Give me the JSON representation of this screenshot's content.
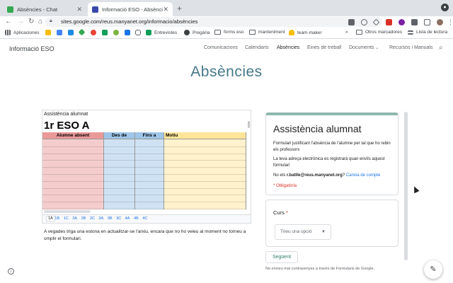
{
  "browser": {
    "tabs": [
      {
        "title": "Absències - Chat",
        "active": false,
        "color": "#34a853"
      },
      {
        "title": "Informació ESO - Absències",
        "active": true,
        "color": "#3949ab"
      }
    ],
    "url": "sites.google.com/reus.manyanet.org/informacio/absències",
    "bookmarks": [
      {
        "label": "Aplicaciones",
        "icon": "apps-grid-icon"
      },
      {
        "label": "Entrevistes",
        "icon": "sheets-icon"
      },
      {
        "label": "Pregària",
        "icon": "globe-icon"
      },
      {
        "label": "forms eso",
        "icon": "folder-icon"
      },
      {
        "label": "manteniment",
        "icon": "folder-icon"
      },
      {
        "label": "team-maker",
        "icon": "bulb-icon"
      },
      {
        "label": "Otros marcadores",
        "icon": "folder-icon"
      },
      {
        "label": "Lista de lectura",
        "icon": "reading-list-icon"
      }
    ],
    "more_bookmarks": "»"
  },
  "site": {
    "title": "Informació ESO",
    "nav": [
      "Comunicacions",
      "Calendaris",
      "Absències",
      "Eines de treball",
      "Documents",
      "Recursos i Manuals"
    ],
    "active_nav": "Absències",
    "page_heading": "Absències"
  },
  "sheet": {
    "label": "Assistència alumnat",
    "heading": "1r ESO A",
    "columns": [
      {
        "name": "Alumne absent",
        "color": "#f4cccc",
        "head": "#ea9999"
      },
      {
        "name": "Des de",
        "color": "#cfe2f3",
        "head": "#9fc5e8"
      },
      {
        "name": "Fins a",
        "color": "#cfe2f3",
        "head": "#9fc5e8"
      },
      {
        "name": "Motiu",
        "color": "#fff2cc",
        "head": "#ffe599"
      }
    ],
    "tabs": [
      "1A",
      "1B",
      "1C",
      "2A",
      "2B",
      "2C",
      "3A",
      "3B",
      "3C",
      "4A",
      "4B",
      "4C"
    ],
    "selected_tab": "1A"
  },
  "note": "A vegades triga una estona en actualitzar-se l'arxiu, encara que no ho veieu al moment no torneu a omplir el formulari.",
  "form": {
    "title": "Assistència alumnat",
    "description": "Formulari justificant l'absència de l'alumne per tal que ho rebin els professors",
    "email_note": "La teva adreça electrònica es registrarà quan enviïs aquest formulari",
    "not_you_prefix": "No ets ",
    "account": "r.batlle@reus.manyanet.org",
    "not_you_suffix": "? ",
    "switch_account": "Canvia de compte",
    "required": "* Obligatòria",
    "question": "Curs",
    "question_required": "*",
    "select_placeholder": "Trieu una opció",
    "next": "Següent",
    "footer": "No envieu mai contrasenyes a través de Formularis de Google."
  }
}
